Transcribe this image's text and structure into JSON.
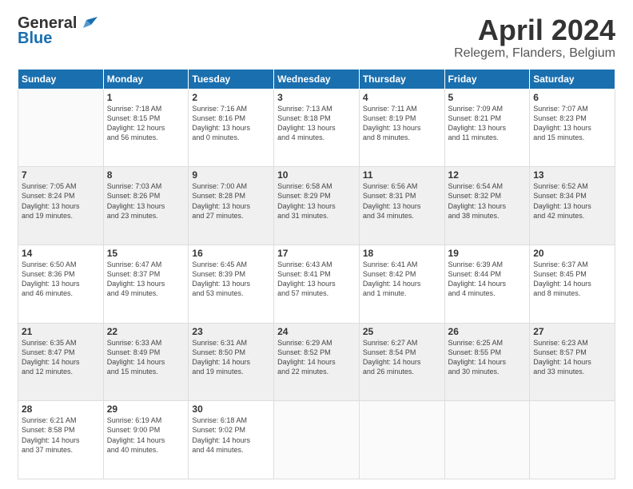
{
  "header": {
    "logo_line1": "General",
    "logo_line2": "Blue",
    "month": "April 2024",
    "location": "Relegem, Flanders, Belgium"
  },
  "weekdays": [
    "Sunday",
    "Monday",
    "Tuesday",
    "Wednesday",
    "Thursday",
    "Friday",
    "Saturday"
  ],
  "weeks": [
    [
      {
        "day": "",
        "info": ""
      },
      {
        "day": "1",
        "info": "Sunrise: 7:18 AM\nSunset: 8:15 PM\nDaylight: 12 hours\nand 56 minutes."
      },
      {
        "day": "2",
        "info": "Sunrise: 7:16 AM\nSunset: 8:16 PM\nDaylight: 13 hours\nand 0 minutes."
      },
      {
        "day": "3",
        "info": "Sunrise: 7:13 AM\nSunset: 8:18 PM\nDaylight: 13 hours\nand 4 minutes."
      },
      {
        "day": "4",
        "info": "Sunrise: 7:11 AM\nSunset: 8:19 PM\nDaylight: 13 hours\nand 8 minutes."
      },
      {
        "day": "5",
        "info": "Sunrise: 7:09 AM\nSunset: 8:21 PM\nDaylight: 13 hours\nand 11 minutes."
      },
      {
        "day": "6",
        "info": "Sunrise: 7:07 AM\nSunset: 8:23 PM\nDaylight: 13 hours\nand 15 minutes."
      }
    ],
    [
      {
        "day": "7",
        "info": "Sunrise: 7:05 AM\nSunset: 8:24 PM\nDaylight: 13 hours\nand 19 minutes."
      },
      {
        "day": "8",
        "info": "Sunrise: 7:03 AM\nSunset: 8:26 PM\nDaylight: 13 hours\nand 23 minutes."
      },
      {
        "day": "9",
        "info": "Sunrise: 7:00 AM\nSunset: 8:28 PM\nDaylight: 13 hours\nand 27 minutes."
      },
      {
        "day": "10",
        "info": "Sunrise: 6:58 AM\nSunset: 8:29 PM\nDaylight: 13 hours\nand 31 minutes."
      },
      {
        "day": "11",
        "info": "Sunrise: 6:56 AM\nSunset: 8:31 PM\nDaylight: 13 hours\nand 34 minutes."
      },
      {
        "day": "12",
        "info": "Sunrise: 6:54 AM\nSunset: 8:32 PM\nDaylight: 13 hours\nand 38 minutes."
      },
      {
        "day": "13",
        "info": "Sunrise: 6:52 AM\nSunset: 8:34 PM\nDaylight: 13 hours\nand 42 minutes."
      }
    ],
    [
      {
        "day": "14",
        "info": "Sunrise: 6:50 AM\nSunset: 8:36 PM\nDaylight: 13 hours\nand 46 minutes."
      },
      {
        "day": "15",
        "info": "Sunrise: 6:47 AM\nSunset: 8:37 PM\nDaylight: 13 hours\nand 49 minutes."
      },
      {
        "day": "16",
        "info": "Sunrise: 6:45 AM\nSunset: 8:39 PM\nDaylight: 13 hours\nand 53 minutes."
      },
      {
        "day": "17",
        "info": "Sunrise: 6:43 AM\nSunset: 8:41 PM\nDaylight: 13 hours\nand 57 minutes."
      },
      {
        "day": "18",
        "info": "Sunrise: 6:41 AM\nSunset: 8:42 PM\nDaylight: 14 hours\nand 1 minute."
      },
      {
        "day": "19",
        "info": "Sunrise: 6:39 AM\nSunset: 8:44 PM\nDaylight: 14 hours\nand 4 minutes."
      },
      {
        "day": "20",
        "info": "Sunrise: 6:37 AM\nSunset: 8:45 PM\nDaylight: 14 hours\nand 8 minutes."
      }
    ],
    [
      {
        "day": "21",
        "info": "Sunrise: 6:35 AM\nSunset: 8:47 PM\nDaylight: 14 hours\nand 12 minutes."
      },
      {
        "day": "22",
        "info": "Sunrise: 6:33 AM\nSunset: 8:49 PM\nDaylight: 14 hours\nand 15 minutes."
      },
      {
        "day": "23",
        "info": "Sunrise: 6:31 AM\nSunset: 8:50 PM\nDaylight: 14 hours\nand 19 minutes."
      },
      {
        "day": "24",
        "info": "Sunrise: 6:29 AM\nSunset: 8:52 PM\nDaylight: 14 hours\nand 22 minutes."
      },
      {
        "day": "25",
        "info": "Sunrise: 6:27 AM\nSunset: 8:54 PM\nDaylight: 14 hours\nand 26 minutes."
      },
      {
        "day": "26",
        "info": "Sunrise: 6:25 AM\nSunset: 8:55 PM\nDaylight: 14 hours\nand 30 minutes."
      },
      {
        "day": "27",
        "info": "Sunrise: 6:23 AM\nSunset: 8:57 PM\nDaylight: 14 hours\nand 33 minutes."
      }
    ],
    [
      {
        "day": "28",
        "info": "Sunrise: 6:21 AM\nSunset: 8:58 PM\nDaylight: 14 hours\nand 37 minutes."
      },
      {
        "day": "29",
        "info": "Sunrise: 6:19 AM\nSunset: 9:00 PM\nDaylight: 14 hours\nand 40 minutes."
      },
      {
        "day": "30",
        "info": "Sunrise: 6:18 AM\nSunset: 9:02 PM\nDaylight: 14 hours\nand 44 minutes."
      },
      {
        "day": "",
        "info": ""
      },
      {
        "day": "",
        "info": ""
      },
      {
        "day": "",
        "info": ""
      },
      {
        "day": "",
        "info": ""
      }
    ]
  ]
}
